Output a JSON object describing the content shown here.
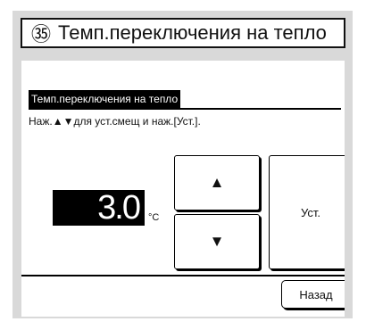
{
  "header": {
    "number": "㉟",
    "title": "Темп.переключения на тепло"
  },
  "screen": {
    "title": "Темп.переключения на тепло",
    "instruction": "Наж.▲▼для уст.смещ и наж.[Уст.].",
    "value": "3.0",
    "unit": "°C",
    "up_label": "▲",
    "down_label": "▼",
    "set_label": "Уст.",
    "back_label": "Назад"
  }
}
